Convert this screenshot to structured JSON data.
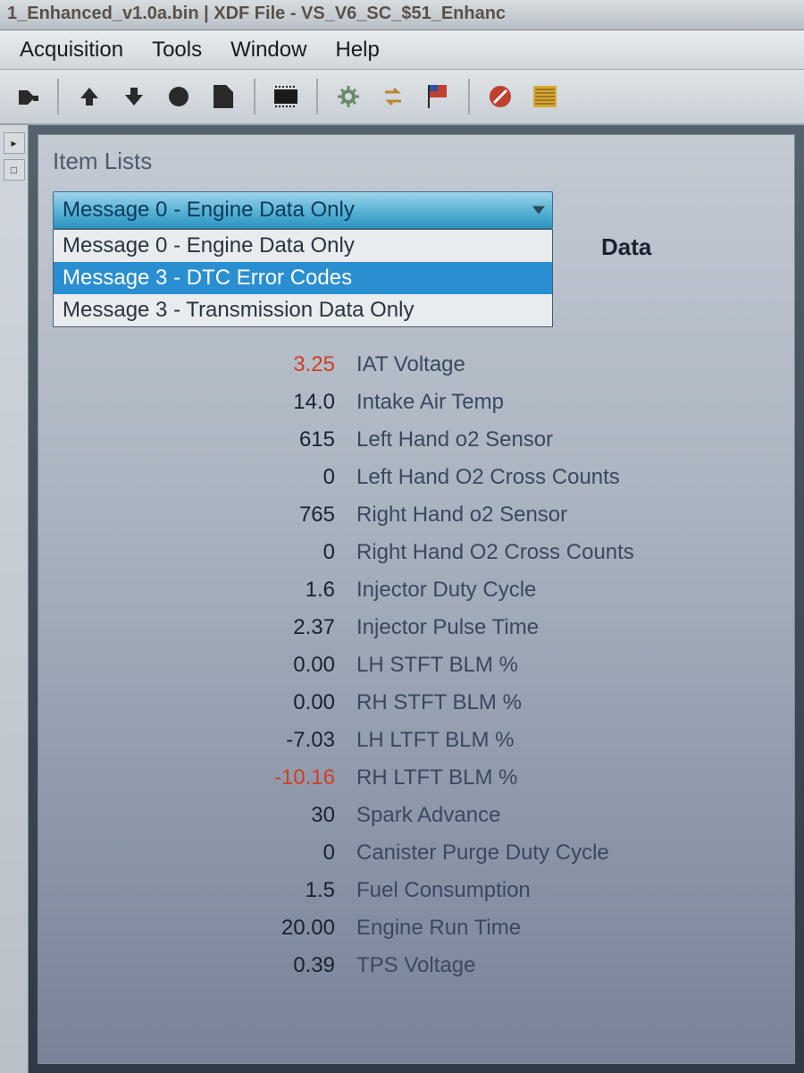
{
  "titlebar": "1_Enhanced_v1.0a.bin | XDF File - VS_V6_SC_$51_Enhanc",
  "menu": {
    "acquisition": "Acquisition",
    "tools": "Tools",
    "window": "Window",
    "help": "Help"
  },
  "toolbar_icons": {
    "connector": "connector-icon",
    "up": "up-arrow-icon",
    "down": "down-arrow-icon",
    "circle": "record-icon",
    "doc": "document-icon",
    "chip": "chip-icon",
    "gear": "gear-icon",
    "swap": "swap-icon",
    "flag": "flag-icon",
    "round": "stop-icon",
    "raw": "raw-icon"
  },
  "panel": {
    "title": "Item Lists",
    "header_col": "Data",
    "dropdown": {
      "selected": "Message 0 - Engine Data Only",
      "options": [
        {
          "label": "Message 0 - Engine Data Only",
          "highlighted": false
        },
        {
          "label": "Message 3 - DTC Error Codes",
          "highlighted": true
        },
        {
          "label": "Message 3 - Transmission Data Only",
          "highlighted": false
        }
      ]
    },
    "rows": [
      {
        "value": "3.25",
        "label": "IAT Voltage",
        "warn": true
      },
      {
        "value": "14.0",
        "label": "Intake Air Temp",
        "warn": false
      },
      {
        "value": "615",
        "label": "Left Hand o2 Sensor",
        "warn": false
      },
      {
        "value": "0",
        "label": "Left Hand O2 Cross Counts",
        "warn": false
      },
      {
        "value": "765",
        "label": "Right Hand o2 Sensor",
        "warn": false
      },
      {
        "value": "0",
        "label": "Right Hand O2 Cross Counts",
        "warn": false
      },
      {
        "value": "1.6",
        "label": "Injector Duty Cycle",
        "warn": false
      },
      {
        "value": "2.37",
        "label": "Injector Pulse Time",
        "warn": false
      },
      {
        "value": "0.00",
        "label": "LH STFT BLM %",
        "warn": false
      },
      {
        "value": "0.00",
        "label": "RH STFT BLM %",
        "warn": false
      },
      {
        "value": "-7.03",
        "label": "LH LTFT BLM %",
        "warn": false
      },
      {
        "value": "-10.16",
        "label": "RH LTFT BLM %",
        "warn": true
      },
      {
        "value": "30",
        "label": "Spark Advance",
        "warn": false
      },
      {
        "value": "0",
        "label": "Canister Purge Duty Cycle",
        "warn": false
      },
      {
        "value": "1.5",
        "label": "Fuel Consumption",
        "warn": false
      },
      {
        "value": "20.00",
        "label": "Engine Run Time",
        "warn": false
      },
      {
        "value": "0.39",
        "label": "TPS Voltage",
        "warn": false
      }
    ]
  }
}
